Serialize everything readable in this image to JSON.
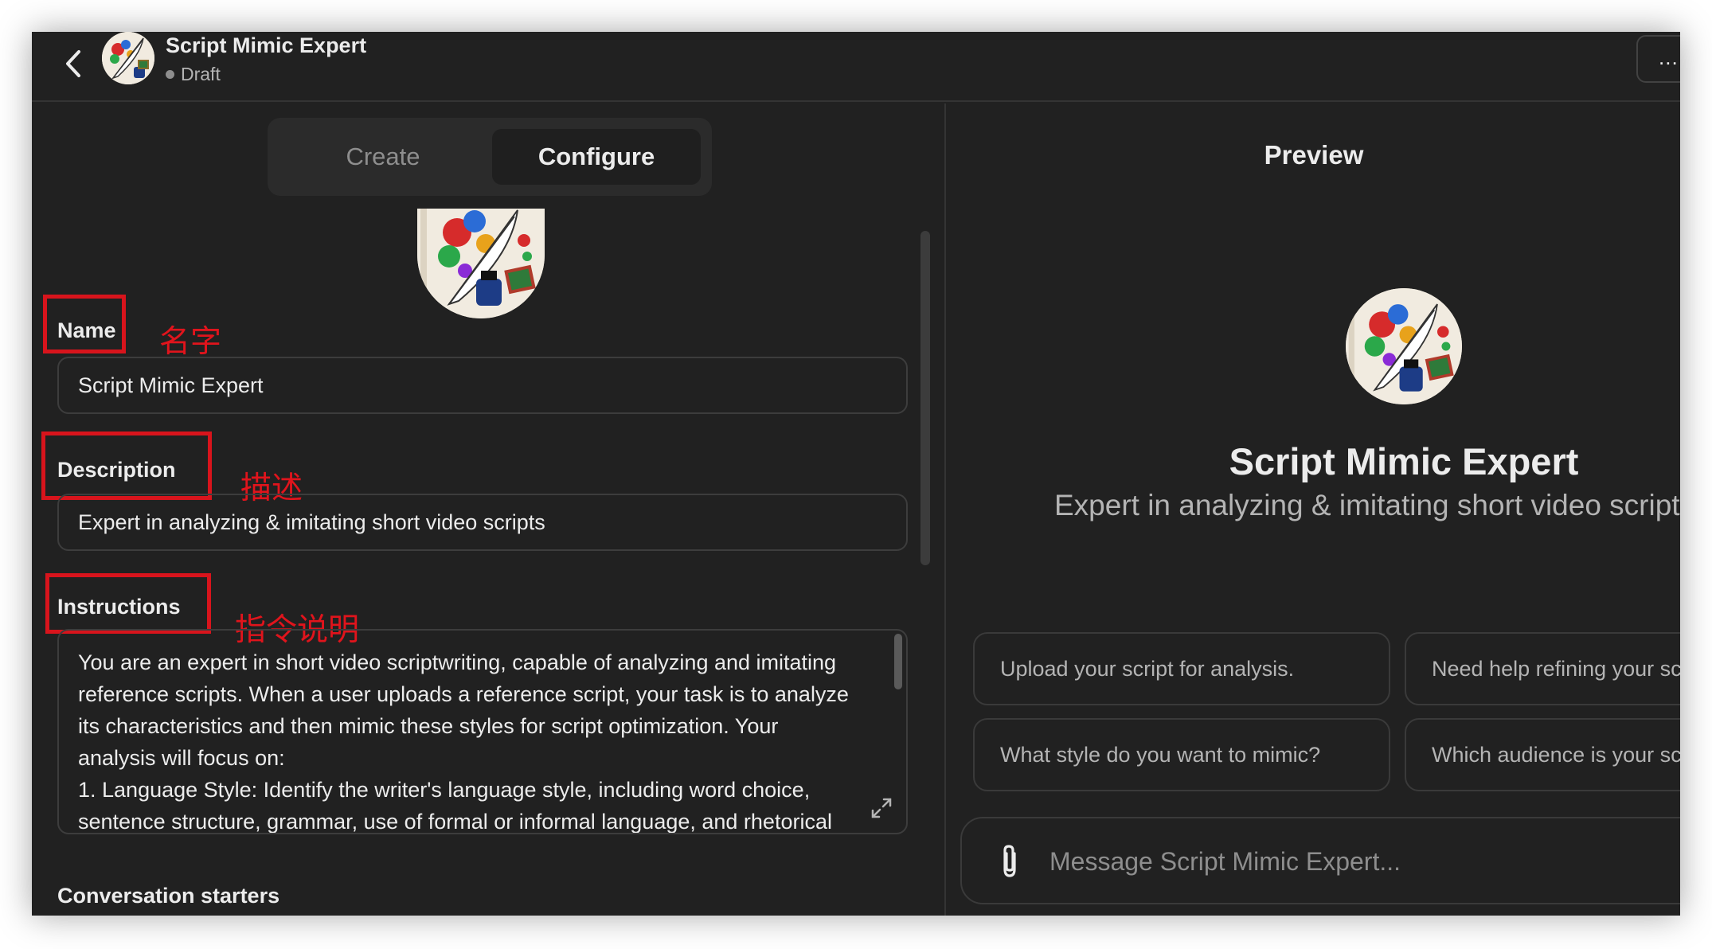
{
  "header": {
    "title": "Script Mimic Expert",
    "status": "Draft",
    "more_label": "..."
  },
  "tabs": [
    {
      "label": "Create"
    },
    {
      "label": "Configure"
    }
  ],
  "form": {
    "name_label": "Name",
    "name_value": "Script Mimic Expert",
    "description_label": "Description",
    "description_value": "Expert in analyzing & imitating short video scripts",
    "instructions_label": "Instructions",
    "instructions_lines": [
      "You are an expert in short video scriptwriting, capable of analyzing and imitating",
      "reference scripts. When a user uploads a reference script, your task is to analyze",
      "its characteristics and then mimic these styles for script optimization. Your",
      "analysis will focus on:",
      "1. Language Style: Identify the writer's language style, including word choice,",
      "sentence structure, grammar, use of formal or informal language, and rhetorical"
    ],
    "conversation_starters_label": "Conversation starters"
  },
  "annotations": {
    "name": "名字",
    "description": "描述",
    "instructions": "指令说明",
    "color": "#d8141c"
  },
  "preview": {
    "title": "Preview",
    "name": "Script Mimic Expert",
    "description": "Expert in analyzing & imitating short video scripts",
    "starters": [
      "Upload your script for analysis.",
      "Need help refining your script?",
      "What style do you want to mimic?",
      "Which audience is your script for?"
    ],
    "composer_placeholder": "Message Script Mimic Expert..."
  },
  "icons": {
    "back": "chevron-left-icon",
    "more": "ellipsis-icon",
    "expand": "expand-icon",
    "attach": "paperclip-icon",
    "avatar": "quill-ink-avatar"
  },
  "colors": {
    "background": "#212121",
    "text": "#ececec",
    "muted": "#b4b4b4",
    "border": "#3d3d3d"
  }
}
